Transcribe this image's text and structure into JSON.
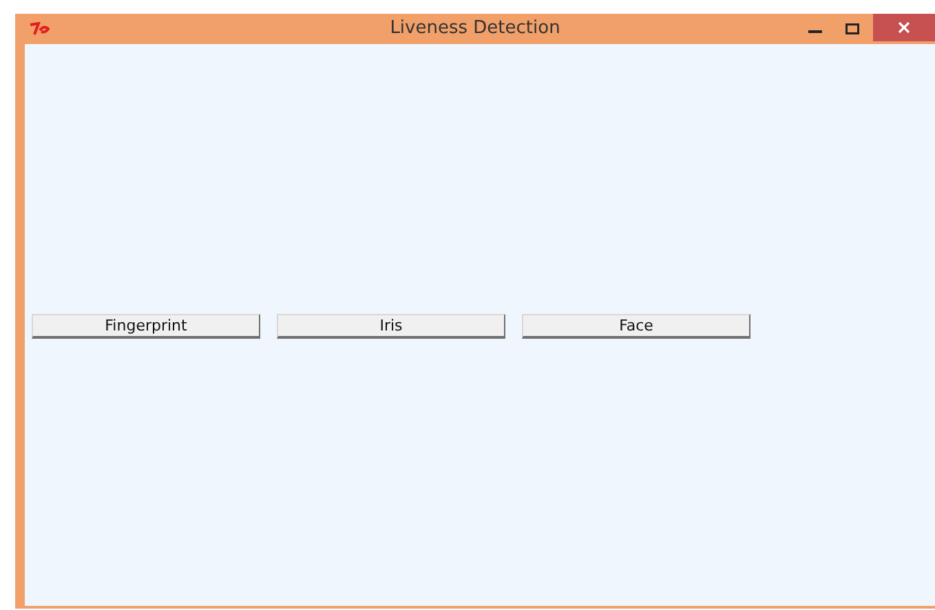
{
  "window": {
    "title": "Liveness Detection"
  },
  "buttons": [
    {
      "label": "Fingerprint"
    },
    {
      "label": "Iris"
    },
    {
      "label": "Face"
    }
  ]
}
